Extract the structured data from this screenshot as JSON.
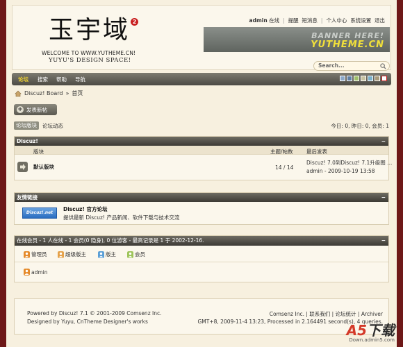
{
  "header": {
    "logo_cn": "玉宇域",
    "logo_badge": "2",
    "logo_line1": "WELCOME TO WWW.YUTHEME.CN!",
    "logo_line2": "YUYU'S DESIGN SPACE!",
    "user": "admin",
    "links": [
      "在线",
      "提醒",
      "短消息",
      "个人中心",
      "系统设置",
      "退出"
    ],
    "banner_line1": "BANNER HERE!",
    "banner_line2": "YUTHEME.CN",
    "search_placeholder": "Search..."
  },
  "nav": {
    "items": [
      "论坛",
      "搜索",
      "帮助",
      "导航"
    ],
    "active": "论坛",
    "swatch_colors": [
      "#8aa7c8",
      "#5f7fa3",
      "#9fbf6a",
      "#c8c2a0",
      "#7ab0c9",
      "#a89a7a",
      "#ffffff"
    ]
  },
  "breadcrumb": {
    "site": "Discuz! Board",
    "sep": "»",
    "current": "首页"
  },
  "new_post_label": "发表新帖",
  "tabs": {
    "active": "论坛版块",
    "other": "论坛动态"
  },
  "stats": "今日: 0, 昨日: 0, 会员: 1",
  "forum_section": {
    "title": "Discuz!",
    "collapse": "−",
    "col_forum": "版块",
    "col_counts": "主题/帖数",
    "col_last": "最后发表",
    "rows": [
      {
        "name": "默认版块",
        "counts": "14 / 14",
        "last_title": "Discuz! 7.0到Discuz! 7.1升级图 ...",
        "last_meta": "admin - 2009-10-19 13:58"
      }
    ]
  },
  "links_section": {
    "title": "友情链接",
    "collapse": "−",
    "logo_text": "Discuz!.net",
    "name": "Discuz! 官方论坛",
    "desc": "提供最新 Discuz! 产品新闻、软件下载与技术交流"
  },
  "online_section": {
    "text": "在线会员 - 1 人在线 - 1 会员(0 隐身), 0 位游客 - 最高记录是 1 于 2002-12-16.",
    "collapse": "−",
    "legend": [
      {
        "label": "管理员",
        "color": "#e58a2a"
      },
      {
        "label": "超级版主",
        "color": "#e5a24a"
      },
      {
        "label": "版主",
        "color": "#5a9fd6"
      },
      {
        "label": "会员",
        "color": "#9ec45a"
      }
    ],
    "users": [
      "admin"
    ]
  },
  "footer": {
    "left1": "Powered by Discuz! 7.1 © 2001-2009 Comsenz Inc.",
    "left2": "Designed by Yuyu, CnTheme Designer's works",
    "right1": "Comsenz Inc. | 联系我们 | 论坛统计 | Archiver",
    "right2": "GMT+8, 2009-11-4 13:23, Processed in 2.164491 second(s), 4 queries."
  },
  "watermark": {
    "brand_a": "A5",
    "brand_b": "下载",
    "url": "Down.admin5.com"
  }
}
